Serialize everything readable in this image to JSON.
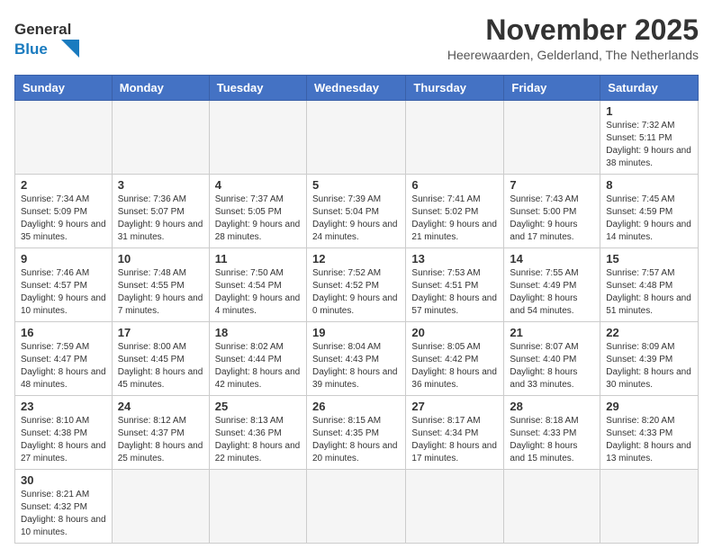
{
  "logo": {
    "line1": "General",
    "line2": "Blue"
  },
  "title": "November 2025",
  "subtitle": "Heerewaarden, Gelderland, The Netherlands",
  "weekdays": [
    "Sunday",
    "Monday",
    "Tuesday",
    "Wednesday",
    "Thursday",
    "Friday",
    "Saturday"
  ],
  "weeks": [
    [
      {
        "day": "",
        "info": ""
      },
      {
        "day": "",
        "info": ""
      },
      {
        "day": "",
        "info": ""
      },
      {
        "day": "",
        "info": ""
      },
      {
        "day": "",
        "info": ""
      },
      {
        "day": "",
        "info": ""
      },
      {
        "day": "1",
        "info": "Sunrise: 7:32 AM\nSunset: 5:11 PM\nDaylight: 9 hours\nand 38 minutes."
      }
    ],
    [
      {
        "day": "2",
        "info": "Sunrise: 7:34 AM\nSunset: 5:09 PM\nDaylight: 9 hours\nand 35 minutes."
      },
      {
        "day": "3",
        "info": "Sunrise: 7:36 AM\nSunset: 5:07 PM\nDaylight: 9 hours\nand 31 minutes."
      },
      {
        "day": "4",
        "info": "Sunrise: 7:37 AM\nSunset: 5:05 PM\nDaylight: 9 hours\nand 28 minutes."
      },
      {
        "day": "5",
        "info": "Sunrise: 7:39 AM\nSunset: 5:04 PM\nDaylight: 9 hours\nand 24 minutes."
      },
      {
        "day": "6",
        "info": "Sunrise: 7:41 AM\nSunset: 5:02 PM\nDaylight: 9 hours\nand 21 minutes."
      },
      {
        "day": "7",
        "info": "Sunrise: 7:43 AM\nSunset: 5:00 PM\nDaylight: 9 hours\nand 17 minutes."
      },
      {
        "day": "8",
        "info": "Sunrise: 7:45 AM\nSunset: 4:59 PM\nDaylight: 9 hours\nand 14 minutes."
      }
    ],
    [
      {
        "day": "9",
        "info": "Sunrise: 7:46 AM\nSunset: 4:57 PM\nDaylight: 9 hours\nand 10 minutes."
      },
      {
        "day": "10",
        "info": "Sunrise: 7:48 AM\nSunset: 4:55 PM\nDaylight: 9 hours\nand 7 minutes."
      },
      {
        "day": "11",
        "info": "Sunrise: 7:50 AM\nSunset: 4:54 PM\nDaylight: 9 hours\nand 4 minutes."
      },
      {
        "day": "12",
        "info": "Sunrise: 7:52 AM\nSunset: 4:52 PM\nDaylight: 9 hours\nand 0 minutes."
      },
      {
        "day": "13",
        "info": "Sunrise: 7:53 AM\nSunset: 4:51 PM\nDaylight: 8 hours\nand 57 minutes."
      },
      {
        "day": "14",
        "info": "Sunrise: 7:55 AM\nSunset: 4:49 PM\nDaylight: 8 hours\nand 54 minutes."
      },
      {
        "day": "15",
        "info": "Sunrise: 7:57 AM\nSunset: 4:48 PM\nDaylight: 8 hours\nand 51 minutes."
      }
    ],
    [
      {
        "day": "16",
        "info": "Sunrise: 7:59 AM\nSunset: 4:47 PM\nDaylight: 8 hours\nand 48 minutes."
      },
      {
        "day": "17",
        "info": "Sunrise: 8:00 AM\nSunset: 4:45 PM\nDaylight: 8 hours\nand 45 minutes."
      },
      {
        "day": "18",
        "info": "Sunrise: 8:02 AM\nSunset: 4:44 PM\nDaylight: 8 hours\nand 42 minutes."
      },
      {
        "day": "19",
        "info": "Sunrise: 8:04 AM\nSunset: 4:43 PM\nDaylight: 8 hours\nand 39 minutes."
      },
      {
        "day": "20",
        "info": "Sunrise: 8:05 AM\nSunset: 4:42 PM\nDaylight: 8 hours\nand 36 minutes."
      },
      {
        "day": "21",
        "info": "Sunrise: 8:07 AM\nSunset: 4:40 PM\nDaylight: 8 hours\nand 33 minutes."
      },
      {
        "day": "22",
        "info": "Sunrise: 8:09 AM\nSunset: 4:39 PM\nDaylight: 8 hours\nand 30 minutes."
      }
    ],
    [
      {
        "day": "23",
        "info": "Sunrise: 8:10 AM\nSunset: 4:38 PM\nDaylight: 8 hours\nand 27 minutes."
      },
      {
        "day": "24",
        "info": "Sunrise: 8:12 AM\nSunset: 4:37 PM\nDaylight: 8 hours\nand 25 minutes."
      },
      {
        "day": "25",
        "info": "Sunrise: 8:13 AM\nSunset: 4:36 PM\nDaylight: 8 hours\nand 22 minutes."
      },
      {
        "day": "26",
        "info": "Sunrise: 8:15 AM\nSunset: 4:35 PM\nDaylight: 8 hours\nand 20 minutes."
      },
      {
        "day": "27",
        "info": "Sunrise: 8:17 AM\nSunset: 4:34 PM\nDaylight: 8 hours\nand 17 minutes."
      },
      {
        "day": "28",
        "info": "Sunrise: 8:18 AM\nSunset: 4:33 PM\nDaylight: 8 hours\nand 15 minutes."
      },
      {
        "day": "29",
        "info": "Sunrise: 8:20 AM\nSunset: 4:33 PM\nDaylight: 8 hours\nand 13 minutes."
      }
    ],
    [
      {
        "day": "30",
        "info": "Sunrise: 8:21 AM\nSunset: 4:32 PM\nDaylight: 8 hours\nand 10 minutes."
      },
      {
        "day": "",
        "info": ""
      },
      {
        "day": "",
        "info": ""
      },
      {
        "day": "",
        "info": ""
      },
      {
        "day": "",
        "info": ""
      },
      {
        "day": "",
        "info": ""
      },
      {
        "day": "",
        "info": ""
      }
    ]
  ]
}
